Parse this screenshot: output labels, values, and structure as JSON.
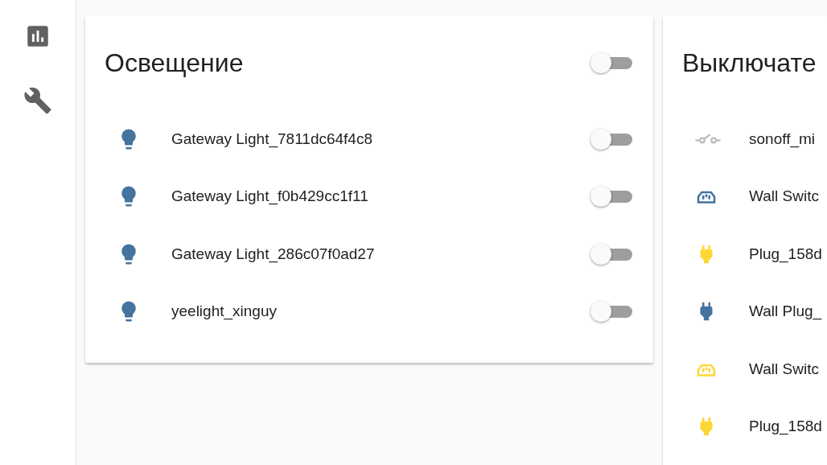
{
  "cards": [
    {
      "title": "Освещение",
      "header_toggle": {
        "on": false
      },
      "entities": [
        {
          "kind": "bulb",
          "active": false,
          "unavailable": false,
          "name": "Gateway Light_7811dc64f4c8",
          "toggle": {
            "on": false
          }
        },
        {
          "kind": "bulb",
          "active": false,
          "unavailable": false,
          "name": "Gateway Light_f0b429cc1f11",
          "toggle": {
            "on": false
          }
        },
        {
          "kind": "bulb",
          "active": false,
          "unavailable": false,
          "name": "Gateway Light_286c07f0ad27",
          "toggle": {
            "on": false
          }
        },
        {
          "kind": "bulb",
          "active": false,
          "unavailable": false,
          "name": "yeelight_xinguy",
          "toggle": {
            "on": false
          }
        }
      ]
    },
    {
      "title": "Выключате",
      "entities": [
        {
          "kind": "switch",
          "active": false,
          "unavailable": true,
          "name": "sonoff_mi"
        },
        {
          "kind": "socket",
          "active": false,
          "unavailable": false,
          "name": "Wall Switc"
        },
        {
          "kind": "plug",
          "active": true,
          "unavailable": false,
          "name": "Plug_158d"
        },
        {
          "kind": "plug",
          "active": false,
          "unavailable": false,
          "name": "Wall Plug_"
        },
        {
          "kind": "socket",
          "active": true,
          "unavailable": false,
          "name": "Wall Switc"
        },
        {
          "kind": "plug",
          "active": true,
          "unavailable": false,
          "name": "Plug_158d"
        }
      ]
    }
  ]
}
